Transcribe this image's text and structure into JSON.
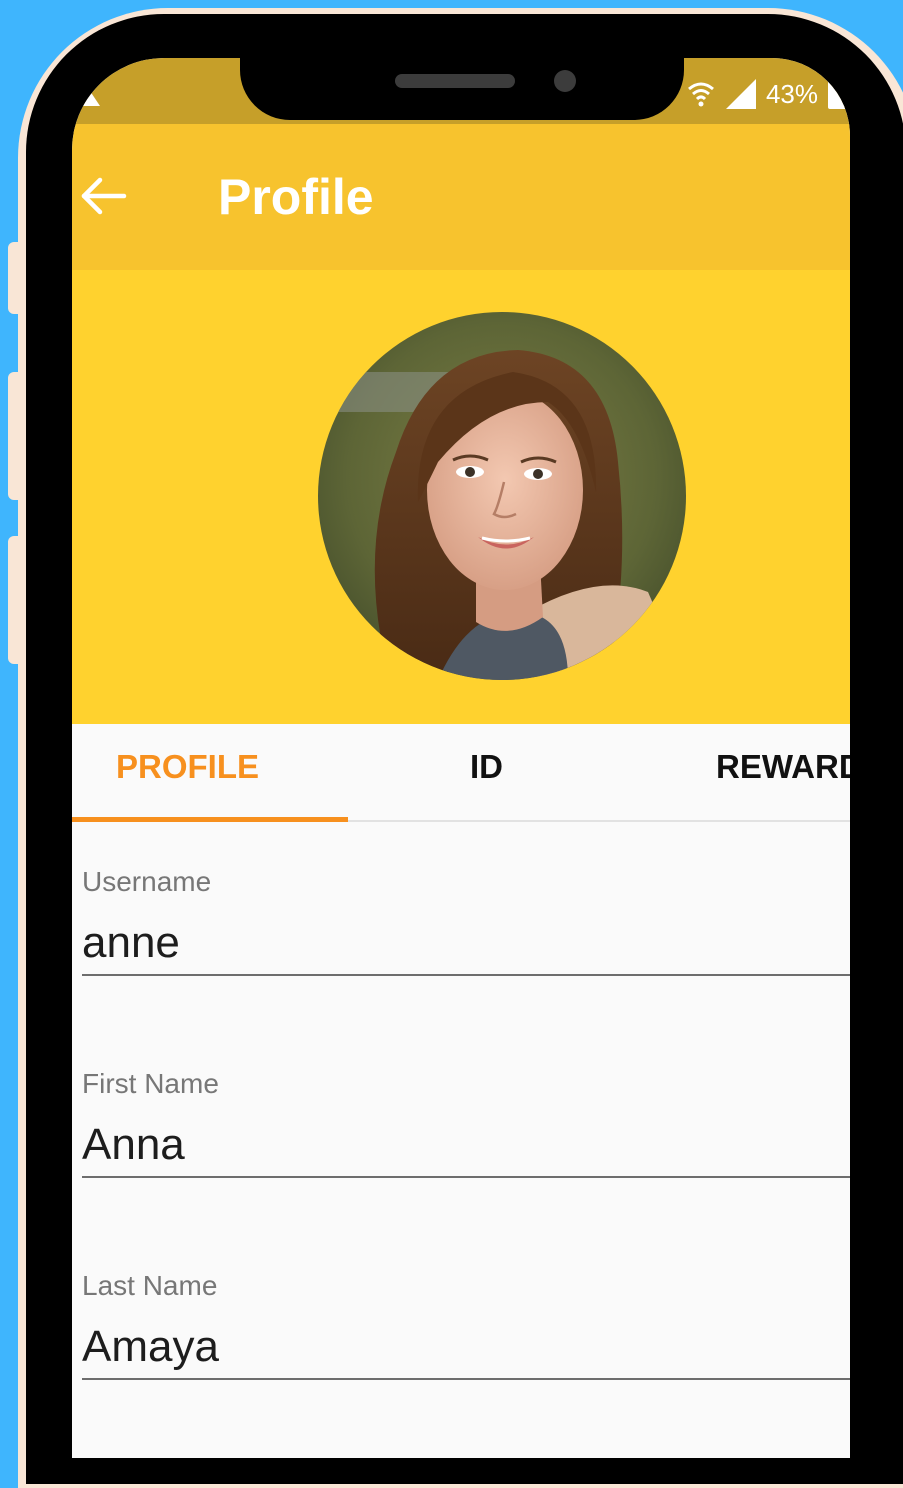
{
  "status_bar": {
    "battery_percent": "43%"
  },
  "app_bar": {
    "title": "Profile"
  },
  "tabs": [
    {
      "label": "PROFILE",
      "active": true
    },
    {
      "label": "ID",
      "active": false
    },
    {
      "label": "REWARD",
      "active": false
    }
  ],
  "fields": [
    {
      "label": "Username",
      "value": "anne"
    },
    {
      "label": "First Name",
      "value": "Anna"
    },
    {
      "label": "Last Name",
      "value": "Amaya"
    }
  ],
  "colors": {
    "background": "#3fb5fd",
    "app_bar": "#f7c32e",
    "header_band": "#ffd22e",
    "status_bar": "#c69f29",
    "tab_active": "#f7901e"
  },
  "icons": {
    "back": "arrow-left-icon",
    "wifi": "wifi-icon",
    "signal": "signal-icon",
    "battery": "battery-icon",
    "status_left": "notification-triangle-icon"
  }
}
